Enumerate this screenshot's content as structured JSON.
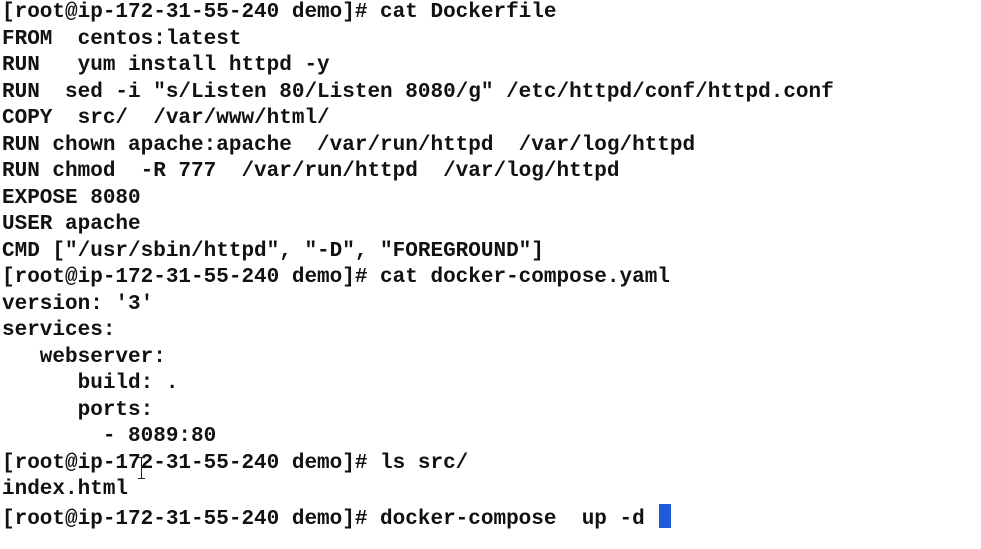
{
  "terminal": {
    "lines": [
      "[root@ip-172-31-55-240 demo]# cat Dockerfile",
      "FROM  centos:latest",
      "RUN   yum install httpd -y",
      "RUN  sed -i \"s/Listen 80/Listen 8080/g\" /etc/httpd/conf/httpd.conf",
      "COPY  src/  /var/www/html/",
      "RUN chown apache:apache  /var/run/httpd  /var/log/httpd",
      "RUN chmod  -R 777  /var/run/httpd  /var/log/httpd",
      "EXPOSE 8080",
      "USER apache",
      "CMD [\"/usr/sbin/httpd\", \"-D\", \"FOREGROUND\"]",
      "[root@ip-172-31-55-240 demo]# cat docker-compose.yaml",
      "version: '3'",
      "services:",
      "   webserver:",
      "      build: .",
      "      ports:",
      "        - 8089:80",
      "[root@ip-172-31-55-240 demo]# ls src/",
      "index.html"
    ],
    "prompt_line": "[root@ip-172-31-55-240 demo]# docker-compose  up -d "
  }
}
